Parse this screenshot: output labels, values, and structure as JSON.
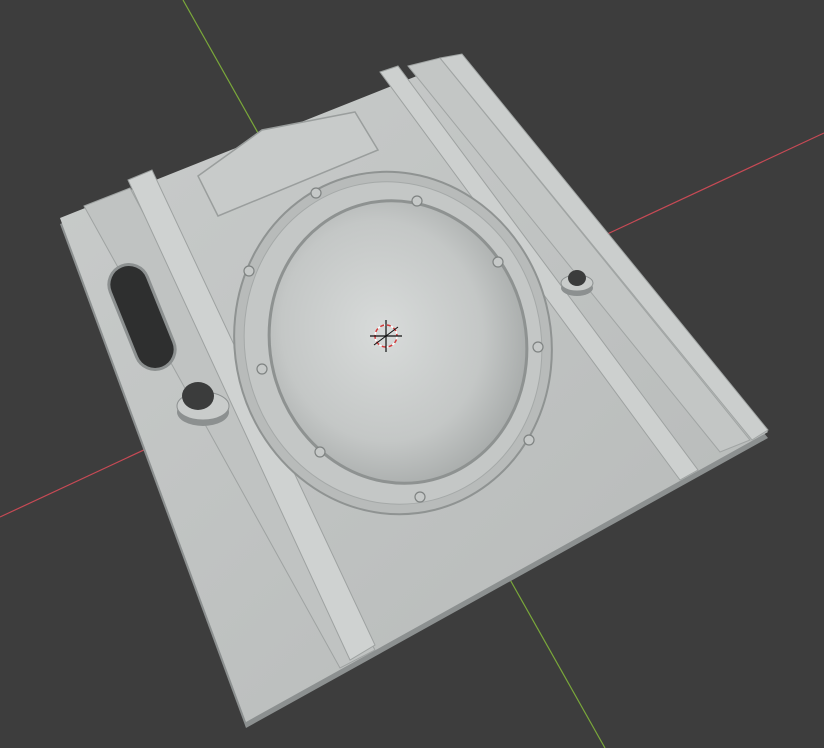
{
  "viewport": {
    "background_color": "#3d3d3d",
    "axis_x_color": "#c74a55",
    "axis_y_color": "#7aa83a",
    "panel_color": "#c3c6c5",
    "panel_shadow_color": "#8c9090",
    "panel_highlight_color": "#dcdfde"
  },
  "scene": {
    "object": "sci-fi-door-panel-mesh",
    "features": [
      "oval-porthole-window",
      "ring-screws",
      "vertical-rails",
      "slot-cutout",
      "round-holes",
      "top-plate-recess"
    ],
    "origin_marker": "3d-cursor-icon"
  }
}
